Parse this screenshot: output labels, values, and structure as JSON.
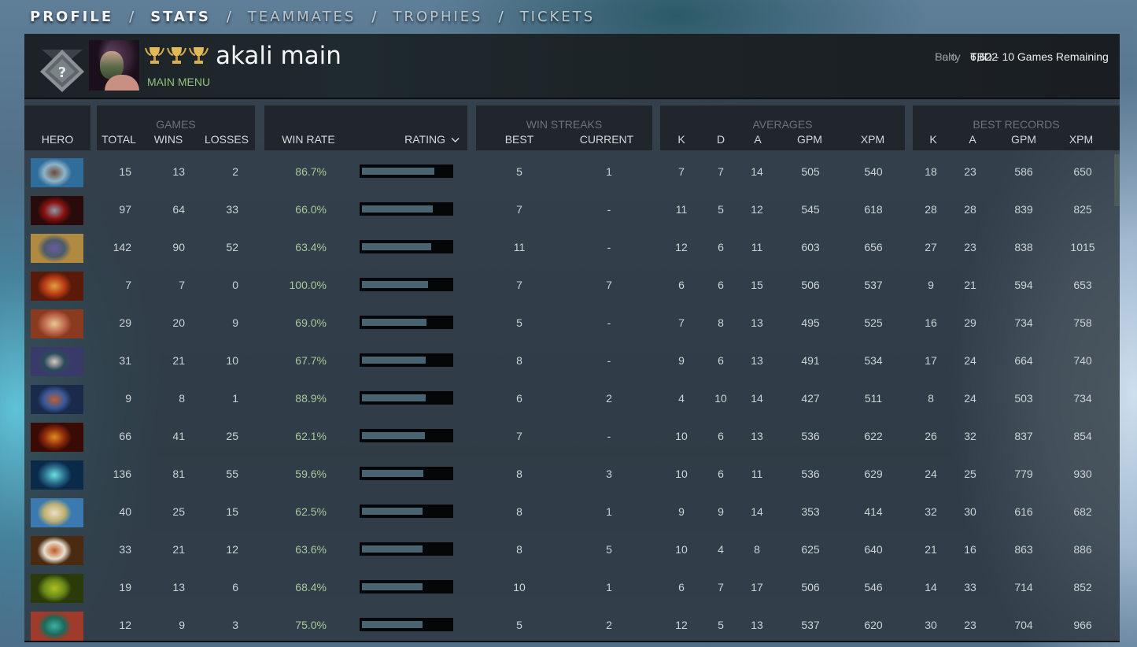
{
  "nav": {
    "tabs": [
      {
        "label": "PROFILE",
        "active": false
      },
      {
        "label": "STATS",
        "active": true
      },
      {
        "label": "TEAMMATES",
        "active": false
      },
      {
        "label": "TROPHIES",
        "active": false
      },
      {
        "label": "TICKETS",
        "active": false
      }
    ],
    "separator": "/"
  },
  "profile": {
    "player_name": "akali main",
    "main_menu_label": "MAIN MENU",
    "rank_icon": "uncalibrated-rank-icon",
    "trophy_count": 3,
    "mmr": {
      "solo_label": "Solo",
      "solo_value": "6,622",
      "party_label": "Party",
      "party_value": "TBD - 10 Games Remaining"
    }
  },
  "table": {
    "groups": {
      "games": "GAMES",
      "win_streaks": "WIN STREAKS",
      "averages": "AVERAGES",
      "best_records": "BEST RECORDS"
    },
    "headers": {
      "hero": "HERO",
      "total": "TOTAL",
      "wins": "WINS",
      "losses": "LOSSES",
      "win_rate": "WIN RATE",
      "rating": "RATING",
      "streak_best": "BEST",
      "streak_current": "CURRENT",
      "avg_k": "K",
      "avg_d": "D",
      "avg_a": "A",
      "avg_gpm": "GPM",
      "avg_xpm": "XPM",
      "best_k": "K",
      "best_a": "A",
      "best_gpm": "GPM",
      "best_xpm": "XPM"
    },
    "sort_indicator": "chevron-down",
    "rows": [
      {
        "hero": "kunkka",
        "total": "15",
        "wins": "13",
        "losses": "2",
        "win_rate": "86.7%",
        "rating": 0.81,
        "streak_best": "5",
        "streak_current": "1",
        "avg_k": "7",
        "avg_d": "7",
        "avg_a": "14",
        "avg_gpm": "505",
        "avg_xpm": "540",
        "best_k": "18",
        "best_a": "23",
        "best_gpm": "586",
        "best_xpm": "650",
        "colors": [
          "#8fb3c9",
          "#6b4a35",
          "#2f6e9a"
        ]
      },
      {
        "hero": "queen-of-pain",
        "total": "97",
        "wins": "64",
        "losses": "33",
        "win_rate": "66.0%",
        "rating": 0.8,
        "streak_best": "7",
        "streak_current": "-",
        "avg_k": "11",
        "avg_d": "5",
        "avg_a": "12",
        "avg_gpm": "545",
        "avg_xpm": "618",
        "best_k": "28",
        "best_a": "28",
        "best_gpm": "839",
        "best_xpm": "825",
        "colors": [
          "#8a1010",
          "#8d9aa8",
          "#2a0b0b"
        ]
      },
      {
        "hero": "tinker",
        "total": "142",
        "wins": "90",
        "losses": "52",
        "win_rate": "63.4%",
        "rating": 0.78,
        "streak_best": "11",
        "streak_current": "-",
        "avg_k": "12",
        "avg_d": "6",
        "avg_a": "11",
        "avg_gpm": "603",
        "avg_xpm": "656",
        "best_k": "27",
        "best_a": "23",
        "best_gpm": "838",
        "best_xpm": "1015",
        "colors": [
          "#4d5b6a",
          "#6a5aa0",
          "#b08a40"
        ]
      },
      {
        "hero": "dragon-knight",
        "total": "7",
        "wins": "7",
        "losses": "0",
        "win_rate": "100.0%",
        "rating": 0.74,
        "streak_best": "7",
        "streak_current": "7",
        "avg_k": "6",
        "avg_d": "6",
        "avg_a": "15",
        "avg_gpm": "506",
        "avg_xpm": "537",
        "best_k": "9",
        "best_a": "21",
        "best_gpm": "594",
        "best_xpm": "653",
        "colors": [
          "#b83a14",
          "#e0a040",
          "#5a1a0a"
        ]
      },
      {
        "hero": "troll-warlord",
        "total": "29",
        "wins": "20",
        "losses": "9",
        "win_rate": "69.0%",
        "rating": 0.73,
        "streak_best": "5",
        "streak_current": "-",
        "avg_k": "7",
        "avg_d": "8",
        "avg_a": "13",
        "avg_gpm": "495",
        "avg_xpm": "525",
        "best_k": "16",
        "best_a": "29",
        "best_gpm": "734",
        "best_xpm": "758",
        "colors": [
          "#c06a50",
          "#e8c890",
          "#8a3a20"
        ]
      },
      {
        "hero": "mirana",
        "total": "31",
        "wins": "21",
        "losses": "10",
        "win_rate": "67.7%",
        "rating": 0.72,
        "streak_best": "8",
        "streak_current": "-",
        "avg_k": "9",
        "avg_d": "6",
        "avg_a": "13",
        "avg_gpm": "491",
        "avg_xpm": "534",
        "best_k": "17",
        "best_a": "24",
        "best_gpm": "664",
        "best_xpm": "740",
        "colors": [
          "#2a4a5a",
          "#d8c8c0",
          "#3a3a6a"
        ]
      },
      {
        "hero": "shadow-shaman-arcana",
        "total": "9",
        "wins": "8",
        "losses": "1",
        "win_rate": "88.9%",
        "rating": 0.72,
        "streak_best": "6",
        "streak_current": "2",
        "avg_k": "4",
        "avg_d": "10",
        "avg_a": "14",
        "avg_gpm": "427",
        "avg_xpm": "511",
        "best_k": "8",
        "best_a": "24",
        "best_gpm": "503",
        "best_xpm": "734",
        "colors": [
          "#3a5a9a",
          "#c06030",
          "#1a2a4a"
        ]
      },
      {
        "hero": "ember-spirit",
        "total": "66",
        "wins": "41",
        "losses": "25",
        "win_rate": "62.1%",
        "rating": 0.71,
        "streak_best": "7",
        "streak_current": "-",
        "avg_k": "10",
        "avg_d": "6",
        "avg_a": "13",
        "avg_gpm": "536",
        "avg_xpm": "622",
        "best_k": "26",
        "best_a": "32",
        "best_gpm": "837",
        "best_xpm": "854",
        "colors": [
          "#8a2a0a",
          "#e08a20",
          "#3a0a05"
        ]
      },
      {
        "hero": "storm-spirit",
        "total": "136",
        "wins": "81",
        "losses": "55",
        "win_rate": "59.6%",
        "rating": 0.69,
        "streak_best": "8",
        "streak_current": "3",
        "avg_k": "10",
        "avg_d": "6",
        "avg_a": "11",
        "avg_gpm": "536",
        "avg_xpm": "629",
        "best_k": "24",
        "best_a": "25",
        "best_gpm": "779",
        "best_xpm": "930",
        "colors": [
          "#2a6a8a",
          "#6ae0e0",
          "#0a2a4a"
        ]
      },
      {
        "hero": "omniknight",
        "total": "40",
        "wins": "25",
        "losses": "15",
        "win_rate": "62.5%",
        "rating": 0.68,
        "streak_best": "8",
        "streak_current": "1",
        "avg_k": "9",
        "avg_d": "9",
        "avg_a": "14",
        "avg_gpm": "353",
        "avg_xpm": "414",
        "best_k": "32",
        "best_a": "30",
        "best_gpm": "616",
        "best_xpm": "682",
        "colors": [
          "#c0b070",
          "#e8e0c8",
          "#3a7ab0"
        ]
      },
      {
        "hero": "lycan",
        "total": "33",
        "wins": "21",
        "losses": "12",
        "win_rate": "63.6%",
        "rating": 0.68,
        "streak_best": "8",
        "streak_current": "5",
        "avg_k": "10",
        "avg_d": "4",
        "avg_a": "8",
        "avg_gpm": "625",
        "avg_xpm": "640",
        "best_k": "21",
        "best_a": "16",
        "best_gpm": "863",
        "best_xpm": "886",
        "colors": [
          "#e8e0d0",
          "#c05a20",
          "#4a2a10"
        ]
      },
      {
        "hero": "venomancer",
        "total": "19",
        "wins": "13",
        "losses": "6",
        "win_rate": "68.4%",
        "rating": 0.68,
        "streak_best": "10",
        "streak_current": "1",
        "avg_k": "6",
        "avg_d": "7",
        "avg_a": "17",
        "avg_gpm": "506",
        "avg_xpm": "546",
        "best_k": "14",
        "best_a": "33",
        "best_gpm": "714",
        "best_xpm": "852",
        "colors": [
          "#6a8a1a",
          "#b0c020",
          "#2a3a0a"
        ]
      },
      {
        "hero": "weaver",
        "total": "12",
        "wins": "9",
        "losses": "3",
        "win_rate": "75.0%",
        "rating": 0.68,
        "streak_best": "5",
        "streak_current": "2",
        "avg_k": "12",
        "avg_d": "5",
        "avg_a": "13",
        "avg_gpm": "537",
        "avg_xpm": "620",
        "best_k": "30",
        "best_a": "23",
        "best_gpm": "704",
        "best_xpm": "966",
        "colors": [
          "#1a6a5a",
          "#40b0a0",
          "#a03a2a"
        ]
      }
    ]
  }
}
